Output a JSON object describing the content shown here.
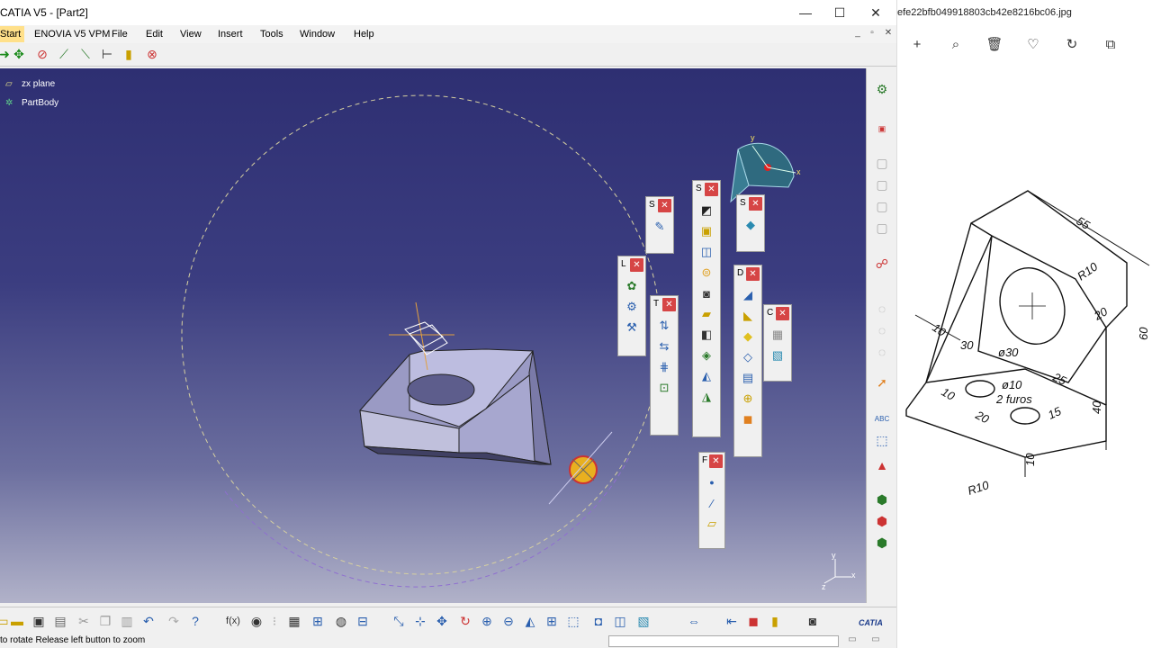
{
  "catia": {
    "title": "CATIA V5 - [Part2]",
    "menu": [
      "Start",
      "ENOVIA V5 VPM",
      "File",
      "Edit",
      "View",
      "Insert",
      "Tools",
      "Window",
      "Help"
    ],
    "tree": {
      "item1": "zx plane",
      "item2": "PartBody"
    },
    "palettes": {
      "sketcher": "S",
      "shapes": "S",
      "surface": "S",
      "lines": "L",
      "transform": "T",
      "dress": "D",
      "clip": "C",
      "reference": "F"
    },
    "status": "to rotate  Release left button to zoom",
    "brand": "CATIA",
    "axes": {
      "x": "x",
      "y": "y",
      "z": "z"
    },
    "compass_axes": {
      "x": "x",
      "y": "y"
    }
  },
  "photos": {
    "filename": "efe22bfb049918803cb42e8216bc06.jpg",
    "dims": {
      "d55": "55",
      "r10_top": "R10",
      "d60": "60",
      "d20_right": "20",
      "d10_left": "10",
      "d30": "30",
      "dia30": "ø30",
      "dia10": "ø10",
      "furos": "2 furos",
      "d25": "25",
      "d10_bottom": "10",
      "d20_bottom": "20",
      "d15": "15",
      "d40": "40",
      "d10_vert": "10",
      "r10_bottom": "R10"
    }
  }
}
